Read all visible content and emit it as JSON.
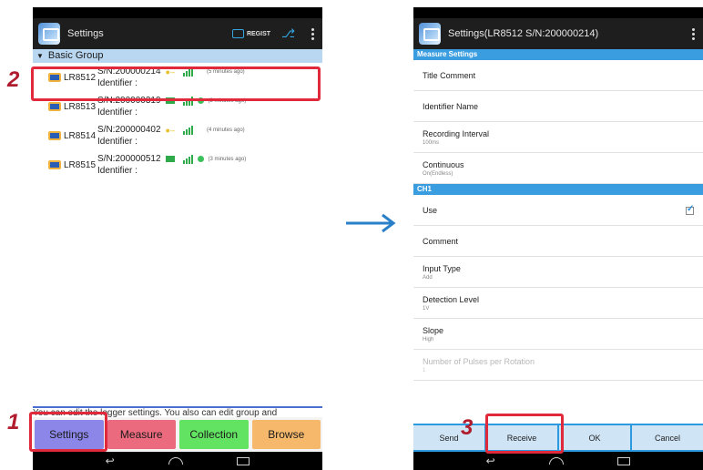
{
  "left_screen": {
    "title": "Settings",
    "regist_label": "REGIST",
    "group_header": "Basic Group",
    "loggers": [
      {
        "model": "LR8512",
        "sn": "S/N:200000214",
        "identifier": "Identifier :",
        "ago": "(5 minutes ago)"
      },
      {
        "model": "LR8513",
        "sn": "S/N:200000319",
        "identifier": "Identifier :",
        "ago": "(2 minutes ago)"
      },
      {
        "model": "LR8514",
        "sn": "S/N:200000402",
        "identifier": "Identifier :",
        "ago": "(4 minutes ago)"
      },
      {
        "model": "LR8515",
        "sn": "S/N:200000512",
        "identifier": "Identifier :",
        "ago": "(3 minutes ago)"
      }
    ],
    "hint": "You can edit the logger settings. You also can edit group and",
    "tabs": [
      "Settings",
      "Measure",
      "Collection",
      "Browse"
    ]
  },
  "right_screen": {
    "title": "Settings(LR8512 S/N:200000214)",
    "sections": [
      {
        "header": "Measure Settings",
        "items": [
          {
            "label": "Title Comment",
            "value": ""
          },
          {
            "label": "Identifier Name",
            "value": ""
          },
          {
            "label": "Recording Interval",
            "value": "100ms"
          },
          {
            "label": "Continuous",
            "value": "On(Endless)"
          }
        ]
      },
      {
        "header": "CH1",
        "items": [
          {
            "label": "Use",
            "value": ""
          },
          {
            "label": "Comment",
            "value": ""
          },
          {
            "label": "Input Type",
            "value": "Add"
          },
          {
            "label": "Detection Level",
            "value": "1V"
          },
          {
            "label": "Slope",
            "value": "High"
          },
          {
            "label": "Number of Pulses per Rotation",
            "value": "1"
          }
        ]
      }
    ],
    "buttons": [
      "Send",
      "Receive",
      "OK",
      "Cancel"
    ]
  },
  "annotations": {
    "step1": "1",
    "step2": "2",
    "step3": "3",
    "highlight_color": "#e02a3c",
    "number_color": "#b01c2e",
    "arrow_color": "#2a7fc9"
  }
}
